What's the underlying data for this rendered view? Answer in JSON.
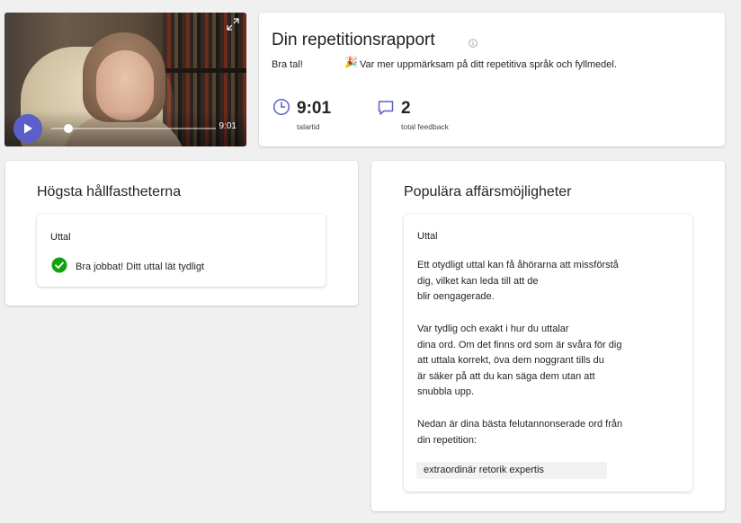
{
  "video": {
    "duration": "9:01",
    "progress": 0.05,
    "icons": {
      "play": "play-icon",
      "expand": "expand-icon"
    }
  },
  "report": {
    "title": "Din repetitionsrapport",
    "praise": "Bra tal!",
    "advice": "Var mer uppmärksam på ditt repetitiva språk och fyllmedel.",
    "party_icon": "🎉",
    "stats": [
      {
        "value": "9:01",
        "label": "talartid",
        "icon": "clock-icon"
      },
      {
        "value": "2",
        "label": "total feedback",
        "icon": "chat-bubble-icon"
      }
    ]
  },
  "strengths": {
    "title": "Högsta hållfastheterna",
    "item_title": "Uttal",
    "item_text": "Bra jobbat! Ditt uttal lät tydligt"
  },
  "opportunities": {
    "title": "Populära affärsmöjligheter",
    "item_title": "Uttal",
    "para1": [
      "Ett otydligt uttal kan få åhörarna att missförstå",
      "dig, vilket kan leda till att de",
      "blir oengagerade."
    ],
    "para2": [
      "Var tydlig och exakt i hur du uttalar",
      "dina ord. Om det finns ord som är svåra för dig",
      "att uttala korrekt, öva dem noggrant tills du",
      "är säker på att du kan säga dem utan att",
      "snubbla upp."
    ],
    "para3": [
      "Nedan är dina bästa felutannonserade ord från",
      "din repetition:"
    ],
    "words": [
      "extraordinär retorik expertis"
    ]
  },
  "colors": {
    "accent": "#5b5fc7",
    "success": "#13a10e",
    "background": "#f0f0f0"
  }
}
